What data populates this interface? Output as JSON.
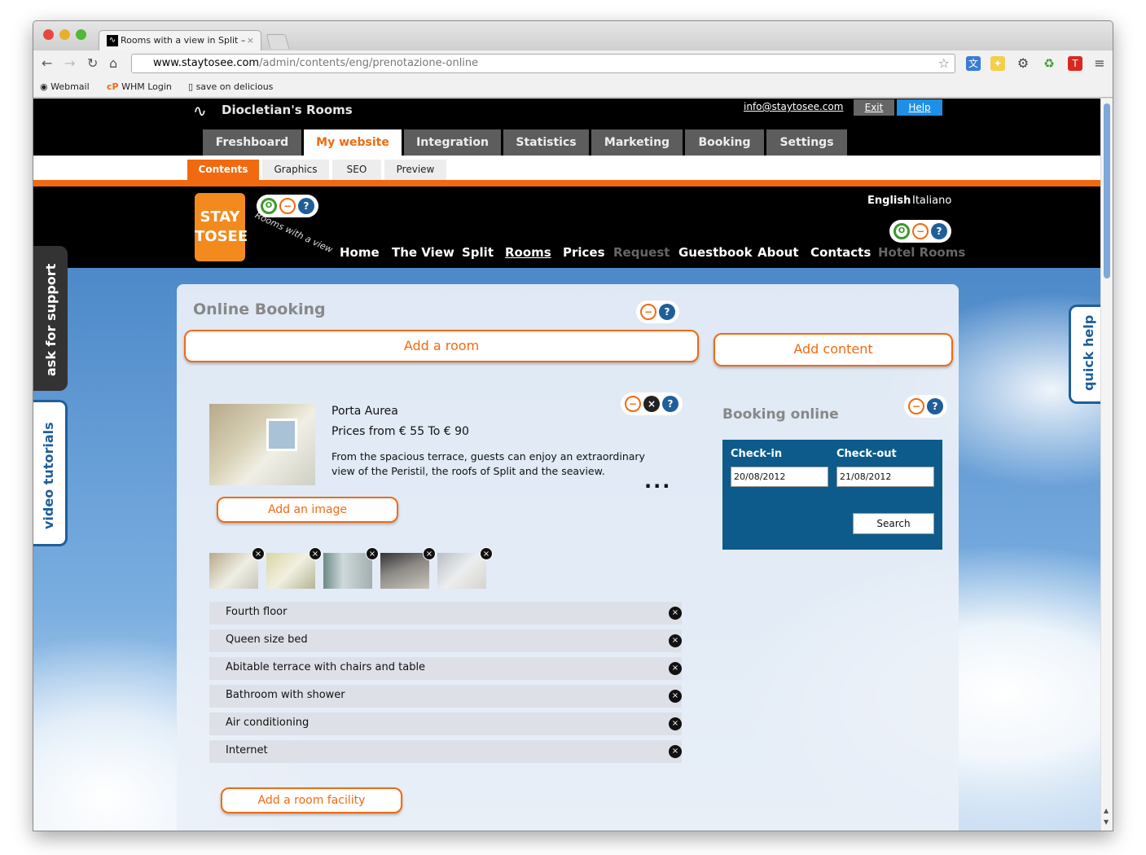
{
  "browser": {
    "tab_title": "Rooms with a view in Split –",
    "tab_close": "×",
    "url_host": "www.staytosee.com",
    "url_path": "/admin/contents/eng/prenotazione-online",
    "bookmarks": [
      "Webmail",
      "WHM Login",
      "save on delicious"
    ]
  },
  "admin": {
    "site_name": "Diocletian's Rooms",
    "email": "info@staytosee.com",
    "exit": "Exit",
    "help": "Help",
    "main_tabs": [
      "Freshboard",
      "My website",
      "Integration",
      "Statistics",
      "Marketing",
      "Booking",
      "Settings"
    ],
    "sub_tabs": [
      "Contents",
      "Graphics",
      "SEO",
      "Preview"
    ]
  },
  "site": {
    "logo_text": "STAY TOSEE",
    "tagline": "Rooms with a view",
    "languages": [
      "English",
      "Italiano"
    ],
    "nav": [
      "Home",
      "The View",
      "Split",
      "Rooms",
      "Prices",
      "Request",
      "Guestbook",
      "About",
      "Contacts",
      "Hotel Rooms"
    ]
  },
  "side": {
    "support": "ask for support",
    "videos": "video tutorials",
    "quick_help": "quick help"
  },
  "content": {
    "title": "Online Booking",
    "add_room": "Add a room",
    "add_content": "Add content",
    "room": {
      "name": "Porta Aurea",
      "price": "Prices from € 55 To € 90",
      "description": "From the spacious terrace, guests can enjoy an extraordinary view of the Peristil, the roofs of Split and the seaview.",
      "more": "..."
    },
    "add_image": "Add an image",
    "facilities": [
      "Fourth floor",
      "Queen size bed",
      "Abitable terrace with chairs and table",
      "Bathroom with shower",
      "Air conditioning",
      "Internet"
    ],
    "add_facility": "Add a room facility"
  },
  "booking": {
    "title": "Booking online",
    "checkin_label": "Check-in",
    "checkout_label": "Check-out",
    "checkin": "20/08/2012",
    "checkout": "21/08/2012",
    "search": "Search"
  },
  "icons": {
    "enable": "O",
    "remove": "−",
    "help": "?",
    "delete": "×"
  },
  "colors": {
    "accent": "#f26a10",
    "booking_box": "#0d5b8a",
    "help_blue": "#1e8fe6"
  }
}
